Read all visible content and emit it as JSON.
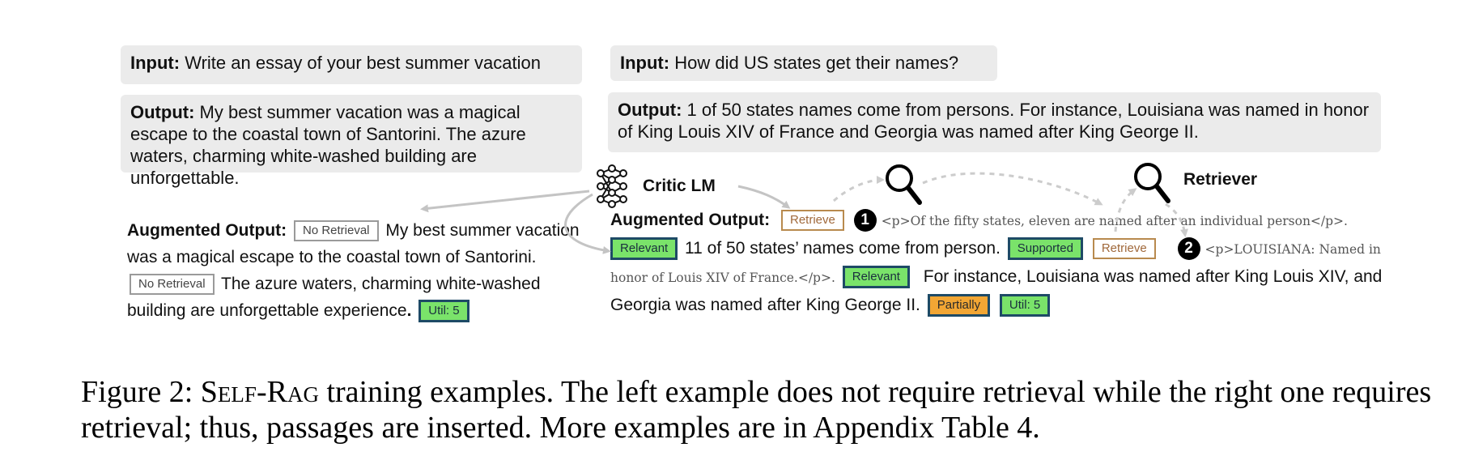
{
  "left": {
    "input_label": "Input:",
    "input_text": "Write an essay of your best summer vacation",
    "output_label": "Output:",
    "output_text": "My best summer vacation was a magical escape to the coastal town of Santorini. The azure waters, charming white-washed building are unforgettable.",
    "aug_label": "Augmented Output:",
    "tag_no_retrieval": "No Retrieval",
    "seg1": "My best summer vacation was a magical escape to the coastal town of Santorini.",
    "seg2": "The azure waters, charming white-washed building are unforgettable experience",
    "seg2_end": ".",
    "tag_util": "Util: 5"
  },
  "right": {
    "input_label": "Input:",
    "input_text": "How did US states get their names?",
    "output_label": "Output:",
    "output_text": "1 of 50 states names come from persons. For instance, Louisiana was named in honor of King Louis XIV of France and Georgia was named after King George II.",
    "aug_label": "Augmented Output:",
    "tag_retrieve": "Retrieve",
    "num1": "1",
    "passage1": "<p>Of the fifty states, eleven are named after an individual person</p>.",
    "tag_relevant": "Relevant",
    "seg1": "11 of 50 states’ names come from person.",
    "tag_supported": "Supported",
    "num2": "2",
    "passage2a": "<p>LOUISIANA: Named in",
    "passage2b": "honor of Louis XIV of France.</p>.",
    "seg2": "For instance, Louisiana was named after King Louis XIV, and",
    "seg3": "Georgia was named after King George II.",
    "tag_partially": "Partially",
    "tag_util": "Util: 5"
  },
  "critic_label": "Critic LM",
  "retriever_label": "Retriever",
  "icons": {
    "critic": "neural-network-icon",
    "retriever": "magnifier-icon"
  },
  "caption": {
    "prefix": "Figure 2: ",
    "name_s": "S",
    "name_elf": "ELF",
    "name_dash": "-",
    "name_r": "R",
    "name_ag": "AG",
    "text": " training examples. The left example does not require retrieval while the right one requires retrieval; thus, passages are inserted. More examples are in Appendix Table 4."
  }
}
